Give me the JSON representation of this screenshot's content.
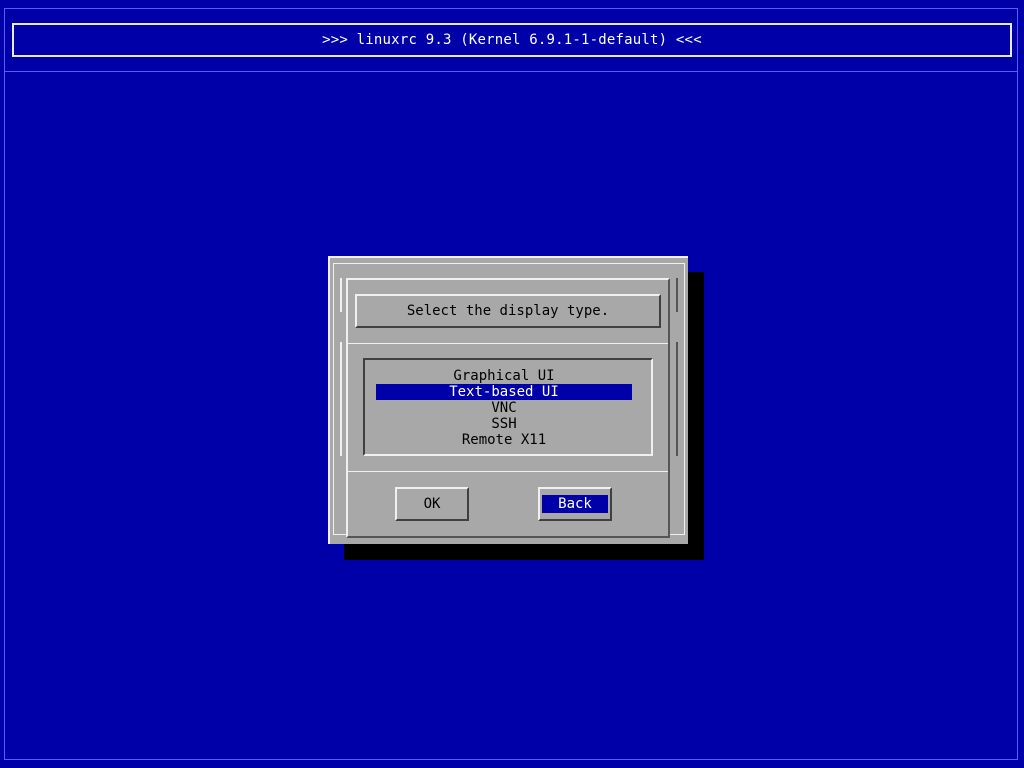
{
  "header": {
    "title": ">>> linuxrc 9.3 (Kernel 6.9.1-1-default) <<<"
  },
  "dialog": {
    "prompt": "Select the display type.",
    "options": [
      {
        "label": "Graphical UI",
        "selected": false
      },
      {
        "label": "Text-based UI",
        "selected": true
      },
      {
        "label": "VNC",
        "selected": false
      },
      {
        "label": "SSH",
        "selected": false
      },
      {
        "label": "Remote X11",
        "selected": false
      }
    ],
    "buttons": {
      "ok_label": "OK",
      "back_label": "Back",
      "focused": "back"
    }
  },
  "colors": {
    "background": "#0000a8",
    "dialog": "#a8a8a8",
    "highlight": "#0000a8",
    "highlight_text": "#ffffff"
  }
}
